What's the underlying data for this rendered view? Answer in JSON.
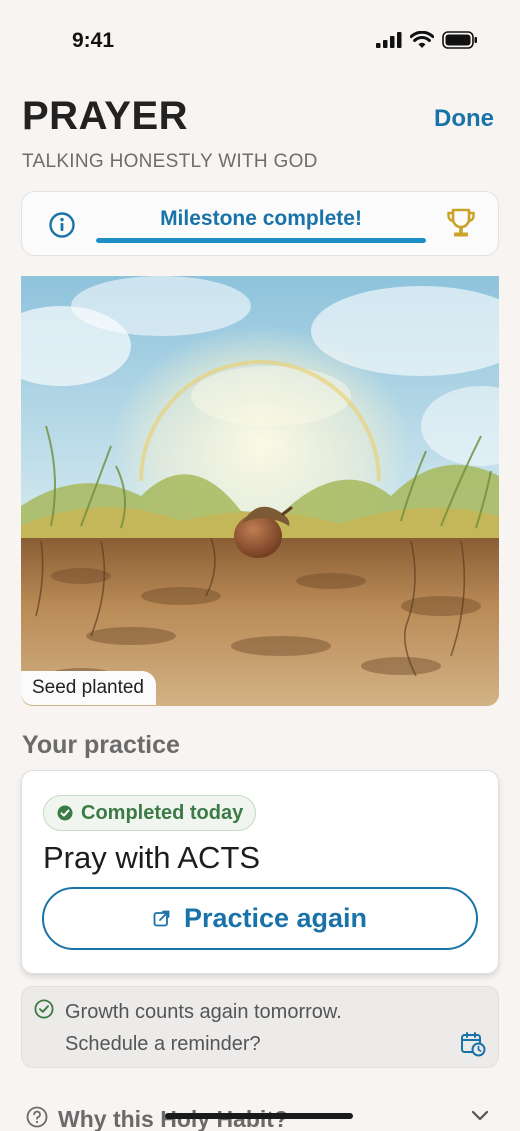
{
  "status_bar": {
    "time": "9:41"
  },
  "header": {
    "title": "PRAYER",
    "subtitle": "TALKING HONESTLY WITH GOD",
    "done_label": "Done"
  },
  "milestone": {
    "text": "Milestone complete!",
    "progress": 1.0
  },
  "illustration": {
    "caption": "Seed planted"
  },
  "practice_section": {
    "title": "Your practice",
    "badge": "Completed today",
    "practice_name": "Pray with ACTS",
    "button_label": "Practice again"
  },
  "reminder": {
    "line1": "Growth counts again tomorrow.",
    "line2": "Schedule a reminder?"
  },
  "why": {
    "text": "Why this Holy Habit?"
  },
  "colors": {
    "accent": "#1a73a8",
    "success": "#3c7a46",
    "trophy": "#c9a227"
  }
}
